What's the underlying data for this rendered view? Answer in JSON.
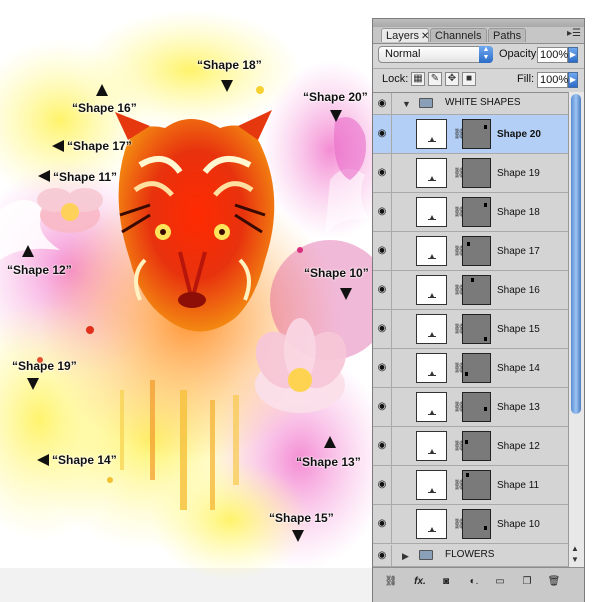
{
  "canvas": {
    "labels": [
      {
        "id": "shape-18",
        "text": "“Shape 18”",
        "arrow": "down"
      },
      {
        "id": "shape-16",
        "text": "“Shape 16”",
        "arrow": "up"
      },
      {
        "id": "shape-20",
        "text": "“Shape 20”",
        "arrow": "down"
      },
      {
        "id": "shape-17",
        "text": "“Shape 17”",
        "arrow": "left"
      },
      {
        "id": "shape-11",
        "text": "“Shape 11”",
        "arrow": "left"
      },
      {
        "id": "shape-12",
        "text": "“Shape 12”",
        "arrow": "up"
      },
      {
        "id": "shape-10",
        "text": "“Shape 10”",
        "arrow": "down"
      },
      {
        "id": "shape-19",
        "text": "“Shape 19”",
        "arrow": "down"
      },
      {
        "id": "shape-14",
        "text": "“Shape 14”",
        "arrow": "left"
      },
      {
        "id": "shape-13",
        "text": "“Shape 13”",
        "arrow": "up"
      },
      {
        "id": "shape-15",
        "text": "“Shape 15”",
        "arrow": "down"
      }
    ]
  },
  "panel": {
    "tabs": [
      "Layers",
      "Channels",
      "Paths"
    ],
    "blend_mode": "Normal",
    "opacity_label": "Opacity:",
    "opacity_value": "100%",
    "lock_label": "Lock:",
    "fill_label": "Fill:",
    "fill_value": "100%",
    "groups": {
      "top": "WHITE SHAPES",
      "bottom": "FLOWERS"
    },
    "layers": [
      "Shape 20",
      "Shape 19",
      "Shape 18",
      "Shape 17",
      "Shape 16",
      "Shape 15",
      "Shape 14",
      "Shape 13",
      "Shape 12",
      "Shape 11",
      "Shape 10"
    ],
    "selected_layer": "Shape 20"
  },
  "colors": {
    "selection": "#b3cff5",
    "accent_blue": "#2c6cc8"
  }
}
